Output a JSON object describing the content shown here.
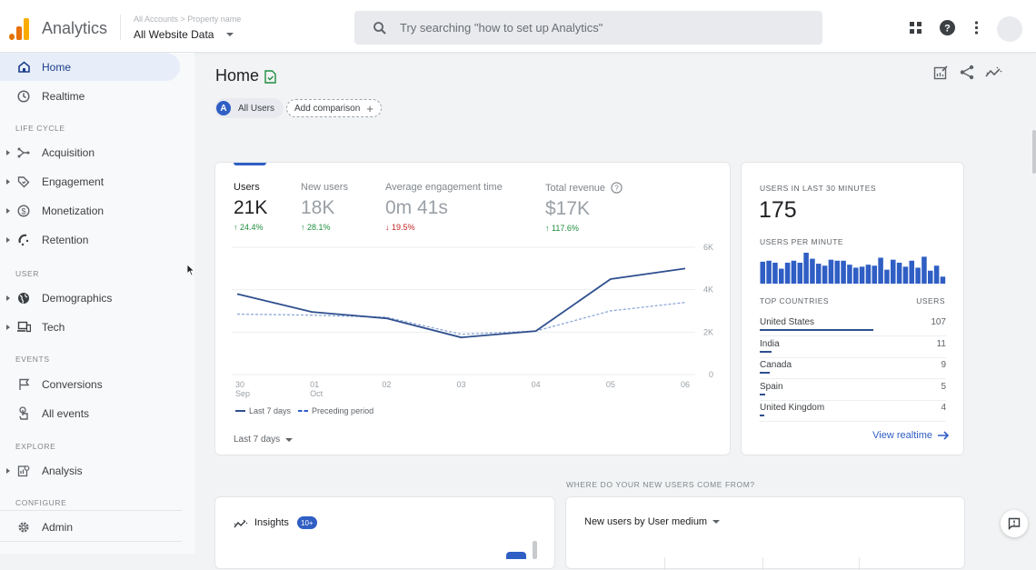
{
  "app": {
    "title": "Analytics",
    "breadcrumb": "All Accounts > Property name",
    "property": "All Website Data",
    "search_placeholder": "Try searching \"how to set up Analytics\"",
    "icons": [
      "apps-grid-icon",
      "help-icon",
      "more-vert-icon",
      "account-avatar"
    ]
  },
  "sidebar": {
    "items_top": [
      {
        "label": "Home",
        "icon": "home-icon",
        "active": true
      },
      {
        "label": "Realtime",
        "icon": "clock-icon"
      }
    ],
    "sections": [
      {
        "title": "LIFE CYCLE",
        "items": [
          {
            "label": "Acquisition",
            "icon": "acquisition-icon",
            "expandable": true
          },
          {
            "label": "Engagement",
            "icon": "tag-icon",
            "expandable": true
          },
          {
            "label": "Monetization",
            "icon": "dollar-icon",
            "expandable": true
          },
          {
            "label": "Retention",
            "icon": "magnet-icon",
            "expandable": true
          }
        ]
      },
      {
        "title": "USER",
        "items": [
          {
            "label": "Demographics",
            "icon": "globe-icon",
            "expandable": true
          },
          {
            "label": "Tech",
            "icon": "devices-icon",
            "expandable": true
          }
        ]
      },
      {
        "title": "EVENTS",
        "items": [
          {
            "label": "Conversions",
            "icon": "flag-icon"
          },
          {
            "label": "All events",
            "icon": "touch-icon"
          }
        ]
      },
      {
        "title": "EXPLORE",
        "items": [
          {
            "label": "Analysis",
            "icon": "analysis-icon",
            "expandable": true
          }
        ]
      },
      {
        "title": "CONFIGURE",
        "items": [
          {
            "label": "Admin",
            "icon": "gear-icon"
          }
        ]
      }
    ]
  },
  "main": {
    "title": "Home",
    "segment_chip": {
      "letter": "A",
      "label": "All Users"
    },
    "add_comparison": "Add comparison",
    "header_icons": [
      "customize-report-icon",
      "share-icon",
      "insights-icon"
    ],
    "overview": {
      "metrics": [
        {
          "label": "Users",
          "value": "21K",
          "delta": "24.4%",
          "direction": "up",
          "selected": true
        },
        {
          "label": "New users",
          "value": "18K",
          "delta": "28.1%",
          "direction": "up"
        },
        {
          "label": "Average engagement time",
          "value": "0m 41s",
          "delta": "19.5%",
          "direction": "down"
        },
        {
          "label": "Total revenue",
          "value": "$17K",
          "delta": "117.6%",
          "direction": "up",
          "help": true
        }
      ],
      "legend": {
        "current": "Last 7 days",
        "previous": "Preceding period"
      },
      "date_range": "Last 7 days"
    },
    "realtime": {
      "users_title": "USERS IN LAST 30 MINUTES",
      "users_value": "175",
      "per_minute_title": "USERS PER MINUTE",
      "per_minute": [
        22,
        23,
        21,
        15,
        21,
        23,
        21,
        31,
        25,
        20,
        18,
        24,
        23,
        23,
        19,
        16,
        17,
        19,
        18,
        26,
        14,
        24,
        21,
        17,
        23,
        16,
        27,
        13,
        18,
        7
      ],
      "countries_header": "TOP COUNTRIES",
      "users_header": "USERS",
      "countries": [
        {
          "name": "United States",
          "users": 107
        },
        {
          "name": "India",
          "users": 11
        },
        {
          "name": "Canada",
          "users": 9
        },
        {
          "name": "Spain",
          "users": 5
        },
        {
          "name": "United Kingdom",
          "users": 4
        }
      ],
      "view_link": "View realtime"
    },
    "where_title": "WHERE DO YOUR NEW USERS COME FROM?",
    "insights": {
      "title": "Insights",
      "badge": "10+"
    },
    "new_users_card": {
      "title": "New users by User medium"
    }
  },
  "chart_data": {
    "type": "line",
    "title": "Users",
    "x": [
      "30 Sep",
      "01 Oct",
      "02",
      "03",
      "04",
      "05",
      "06"
    ],
    "x_ticks": [
      [
        "30",
        "Sep"
      ],
      [
        "01",
        "Oct"
      ],
      [
        "02",
        ""
      ],
      [
        "03",
        ""
      ],
      [
        "04",
        ""
      ],
      [
        "05",
        ""
      ],
      [
        "06",
        ""
      ]
    ],
    "series": [
      {
        "name": "Last 7 days",
        "style": "solid",
        "values": [
          3800,
          2950,
          2650,
          1750,
          2050,
          4500,
          5000
        ]
      },
      {
        "name": "Preceding period",
        "style": "dashed",
        "values": [
          2850,
          2800,
          2700,
          1900,
          2050,
          3000,
          3400
        ]
      }
    ],
    "ylim": [
      0,
      6000
    ],
    "y_ticks": [
      "0",
      "2K",
      "4K",
      "6K"
    ],
    "y_tick_values": [
      0,
      2000,
      4000,
      6000
    ],
    "y_axis_side": "right",
    "grid": true,
    "legend": "bottom-left"
  }
}
